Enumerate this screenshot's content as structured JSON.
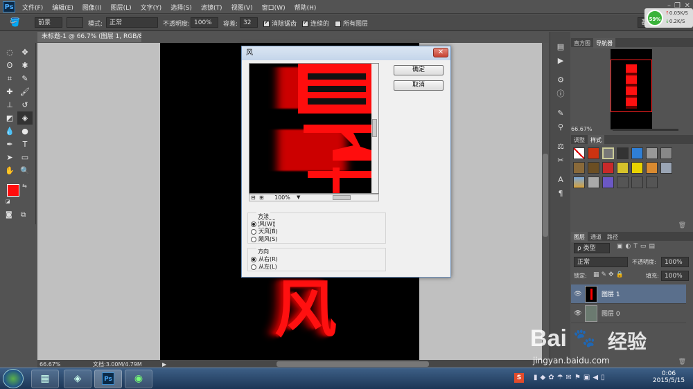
{
  "menubar": {
    "logo": "Ps",
    "menus": [
      "文件(F)",
      "编辑(E)",
      "图像(I)",
      "图层(L)",
      "文字(Y)",
      "选择(S)",
      "滤镜(T)",
      "视图(V)",
      "窗口(W)",
      "帮助(H)"
    ]
  },
  "optbar": {
    "fill_source": "前景",
    "mode_label": "模式:",
    "mode_value": "正常",
    "opacity_label": "不透明度:",
    "opacity_value": "100%",
    "tolerance_label": "容差:",
    "tolerance_value": "32",
    "antialias": "消除锯齿",
    "contiguous": "连续的",
    "all_layers": "所有图层",
    "right_btn": "基"
  },
  "netwidget": {
    "percent": "59%",
    "up": "0.05K/S",
    "down": "0.2K/S"
  },
  "document": {
    "tab": "未标题-1 @ 66.7% (图层 1, RGB/8) *",
    "zoom": "66.67%",
    "doc_info": "文档:3.00M/4.79M"
  },
  "dialog": {
    "title": "风",
    "ok": "确定",
    "cancel": "取消",
    "preview_zoom": "100%",
    "method_label": "方法",
    "methods": [
      "风(W)",
      "大风(B)",
      "飓风(S)"
    ],
    "direction_label": "方向",
    "directions": [
      "从右(R)",
      "从左(L)"
    ]
  },
  "panels": {
    "nav_tabs": [
      "直方图",
      "导航器"
    ],
    "nav_zoom": "66.67%",
    "style_tabs": [
      "调整",
      "样式"
    ],
    "layer_tabs": [
      "图层",
      "通道",
      "路径"
    ],
    "kind_label": "ρ 类型",
    "blend": "正常",
    "opacity_label": "不透明度:",
    "opacity_value": "100%",
    "lock_label": "锁定:",
    "fill_label": "填充:",
    "fill_value": "100%",
    "layers": [
      "图层 1",
      "图层 0"
    ],
    "thumb_text": "风"
  },
  "canvas": {
    "bottom_char": "风"
  },
  "watermark": {
    "brand": "Bai",
    "brand2": "经验",
    "url": "jingyan.baidu.com"
  },
  "taskbar": {
    "time": "0:06",
    "date": "2015/5/15"
  },
  "colors": {
    "accent_red": "#ff1010",
    "selected_layer": "#5a6f8c"
  }
}
